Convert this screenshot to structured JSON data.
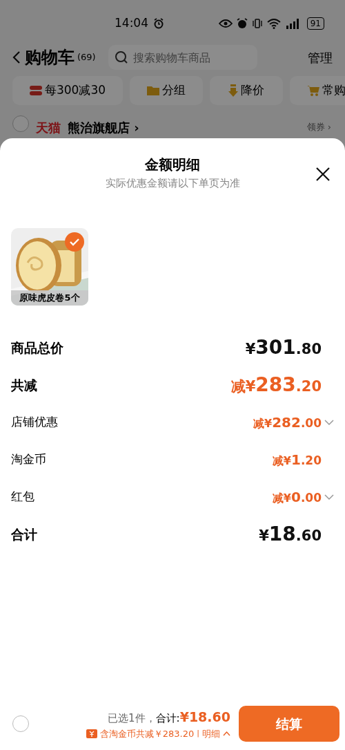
{
  "status_bar": {
    "time": "14:04",
    "battery": "91"
  },
  "header": {
    "title": "购物车",
    "count": "(69)",
    "search_placeholder": "搜索购物车商品",
    "manage": "管理"
  },
  "chips": [
    {
      "kind": "coupon",
      "label": "每300减30"
    },
    {
      "kind": "folder",
      "label": "分组"
    },
    {
      "kind": "down",
      "label": "降价"
    },
    {
      "kind": "cart",
      "label": "常购"
    }
  ],
  "store": {
    "checked": false,
    "badge": "天猫",
    "name": "熊治旗舰店 ›",
    "action": "领券 ›"
  },
  "sheet": {
    "title": "金额明细",
    "subtitle": "实际优惠金额请以下单页为准",
    "product": {
      "caption": "原味虎皮卷5个",
      "selected": true
    },
    "rows": [
      {
        "label": "商品总价",
        "strong": true,
        "accent": false,
        "prefix": "¥",
        "integer": "301",
        "decimal": ".80",
        "expandable": false
      },
      {
        "label": "共减",
        "strong": true,
        "accent": true,
        "prefix": "减¥",
        "integer": "283",
        "decimal": ".20",
        "expandable": false
      },
      {
        "label": "店铺优惠",
        "strong": false,
        "accent": true,
        "prefix": "减¥",
        "integer": "282",
        "decimal": ".00",
        "expandable": true
      },
      {
        "label": "淘金币",
        "strong": false,
        "accent": true,
        "prefix": "减¥",
        "integer": "1",
        "decimal": ".20",
        "expandable": false
      },
      {
        "label": "红包",
        "strong": false,
        "accent": true,
        "prefix": "减¥",
        "integer": "0",
        "decimal": ".00",
        "expandable": true
      },
      {
        "label": "合计",
        "strong": true,
        "accent": false,
        "prefix": "¥",
        "integer": "18",
        "decimal": ".60",
        "expandable": false
      }
    ]
  },
  "footer": {
    "checked": false,
    "selected_count": "已选1件，",
    "total_label": "合计:",
    "total": "¥18.60",
    "discount": "含淘金币共减￥283.20",
    "separator": "|",
    "details": "明细",
    "button": "结算"
  }
}
